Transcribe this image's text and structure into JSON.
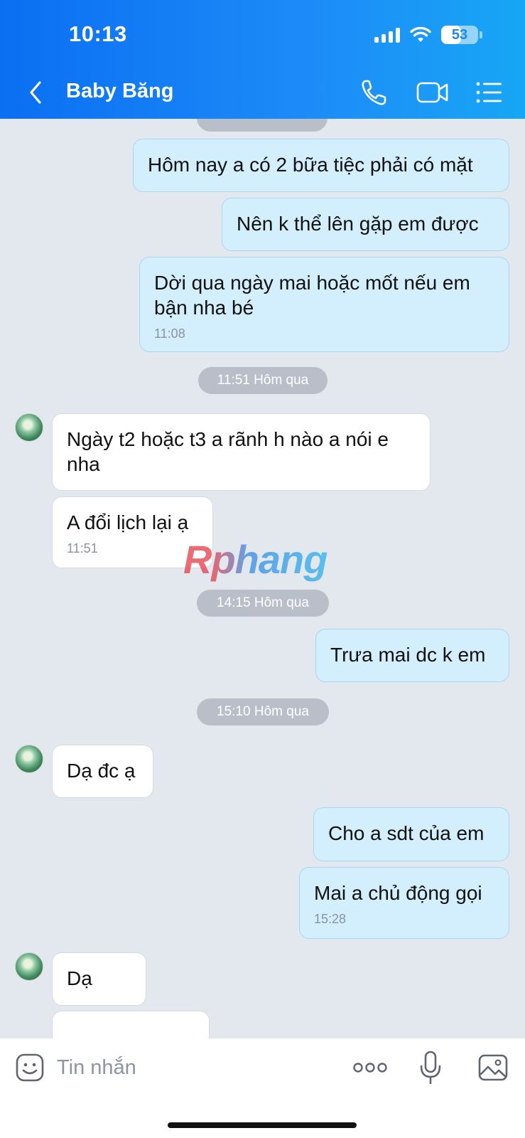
{
  "status_bar": {
    "time": "10:13",
    "battery": "53"
  },
  "header": {
    "title": "Baby Băng"
  },
  "messages": [
    {
      "dir": "out",
      "text": "Hôm nay a có 2 bữa tiệc phải có mặt"
    },
    {
      "dir": "out",
      "text": "Nên k thể lên gặp em được"
    },
    {
      "dir": "out",
      "text": "Dời qua ngày mai hoặc mốt nếu em bận nha bé",
      "time": "11:08"
    },
    {
      "dir": "sep",
      "text": "11:51 Hôm qua"
    },
    {
      "dir": "in",
      "text": "Ngày t2 hoặc t3 a rãnh h nào a nói e nha"
    },
    {
      "dir": "in",
      "text": "A đổi lịch lại ạ",
      "time": "11:51"
    },
    {
      "dir": "sep",
      "text": "14:15 Hôm qua"
    },
    {
      "dir": "out",
      "text": "Trưa mai dc k em"
    },
    {
      "dir": "sep",
      "text": "15:10 Hôm qua"
    },
    {
      "dir": "in",
      "text": "Dạ đc ạ"
    },
    {
      "dir": "out",
      "text": "Cho a sdt của em"
    },
    {
      "dir": "out",
      "text": "Mai a chủ động gọi",
      "time": "15:28"
    },
    {
      "dir": "in",
      "text": "Dạ"
    }
  ],
  "watermark": "Rphang",
  "composer": {
    "placeholder": "Tin nhắn"
  },
  "icons": {
    "back": "chevron-left-icon",
    "call": "phone-icon",
    "video": "video-camera-icon",
    "menu": "list-menu-icon",
    "emoji": "sticker-face-icon",
    "more": "more-dots-icon",
    "mic": "microphone-icon",
    "image": "image-icon"
  },
  "colors": {
    "header_start": "#0a6ff2",
    "header_end": "#17a6f5",
    "outgoing_bubble": "#d3eefc",
    "incoming_bubble": "#ffffff",
    "chat_background": "#e3e8ef"
  }
}
